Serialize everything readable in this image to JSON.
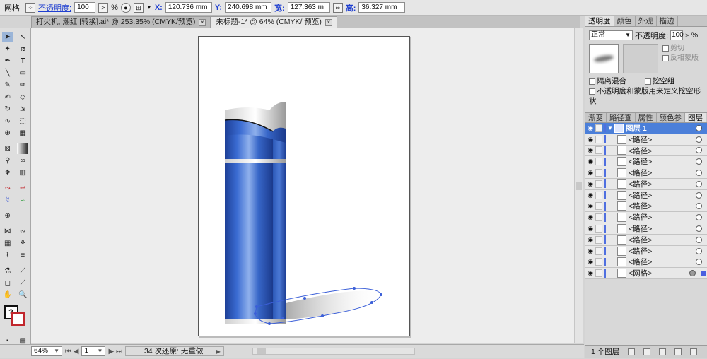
{
  "control_bar": {
    "tool_name": "网格",
    "opacity_label": "不透明度:",
    "opacity_value": "100",
    "opacity_unit": "%",
    "x_label": "X:",
    "x_value": "120.736 mm",
    "y_label": "Y:",
    "y_value": "240.698 mm",
    "w_label": "宽:",
    "w_value": "127.363 m",
    "h_label": "高:",
    "h_value": "36.327 mm"
  },
  "doc_tabs": [
    {
      "label": "打火机, 潮红 [转换].ai* @ 253.35% (CMYK/预览)",
      "active": false
    },
    {
      "label": "未标题-1* @ 64% (CMYK/ 预览)",
      "active": true
    }
  ],
  "tools_icons": [
    [
      "selection-tool",
      "direct-selection-tool"
    ],
    [
      "magic-wand-tool",
      "lasso-tool"
    ],
    [
      "pen-tool",
      "type-tool"
    ],
    [
      "line-tool",
      "rectangle-tool"
    ],
    [
      "paintbrush-tool",
      "pencil-tool"
    ],
    [
      "blob-brush-tool",
      "eraser-tool"
    ],
    [
      "rotate-tool",
      "scale-tool"
    ],
    [
      "warp-tool",
      "free-transform-tool"
    ],
    [
      "shape-builder-tool",
      "perspective-grid-tool"
    ],
    [
      "mesh-tool",
      "gradient-tool"
    ],
    [
      "eyedropper-tool",
      "blend-tool"
    ],
    [
      "symbol-sprayer-tool",
      "column-graph-tool"
    ],
    [
      "artboard-tool",
      "slice-tool"
    ],
    [
      "hand-tool",
      "zoom-tool"
    ]
  ],
  "status_bar": {
    "zoom": "64%",
    "page": "1",
    "undo_count": "34 次还原",
    "redo_label": "无重做"
  },
  "panel_top": {
    "tabs": [
      "透明度",
      "颜色",
      "外观",
      "描边"
    ],
    "active_tab": "透明度",
    "blend_mode": "正常",
    "opacity_label": "不透明度:",
    "opacity_value": "100",
    "opacity_unit": "%",
    "clip_label": "剪切",
    "invert_mask_label": "反相蒙版",
    "isolate_blending": "隔离混合",
    "knockout_group": "挖空组",
    "opacity_mask_knockout": "不透明度和蒙版用来定义挖空形状"
  },
  "panel_layers": {
    "tabs": [
      "渐变",
      "路径查",
      "属性",
      "颜色参",
      "图层"
    ],
    "active_tab": "图层",
    "layer_name": "图层 1",
    "items": [
      "<路径>",
      "<路径>",
      "<路径>",
      "<路径>",
      "<路径>",
      "<路径>",
      "<路径>",
      "<路径>",
      "<路径>",
      "<路径>",
      "<路径>",
      "<路径>",
      "<网格>"
    ],
    "footer_count": "1 个图层"
  },
  "colors": {
    "accent_blue": "#2a55b8",
    "layer_highlight": "#4b7fd9",
    "stroke_red": "#c1272d"
  }
}
